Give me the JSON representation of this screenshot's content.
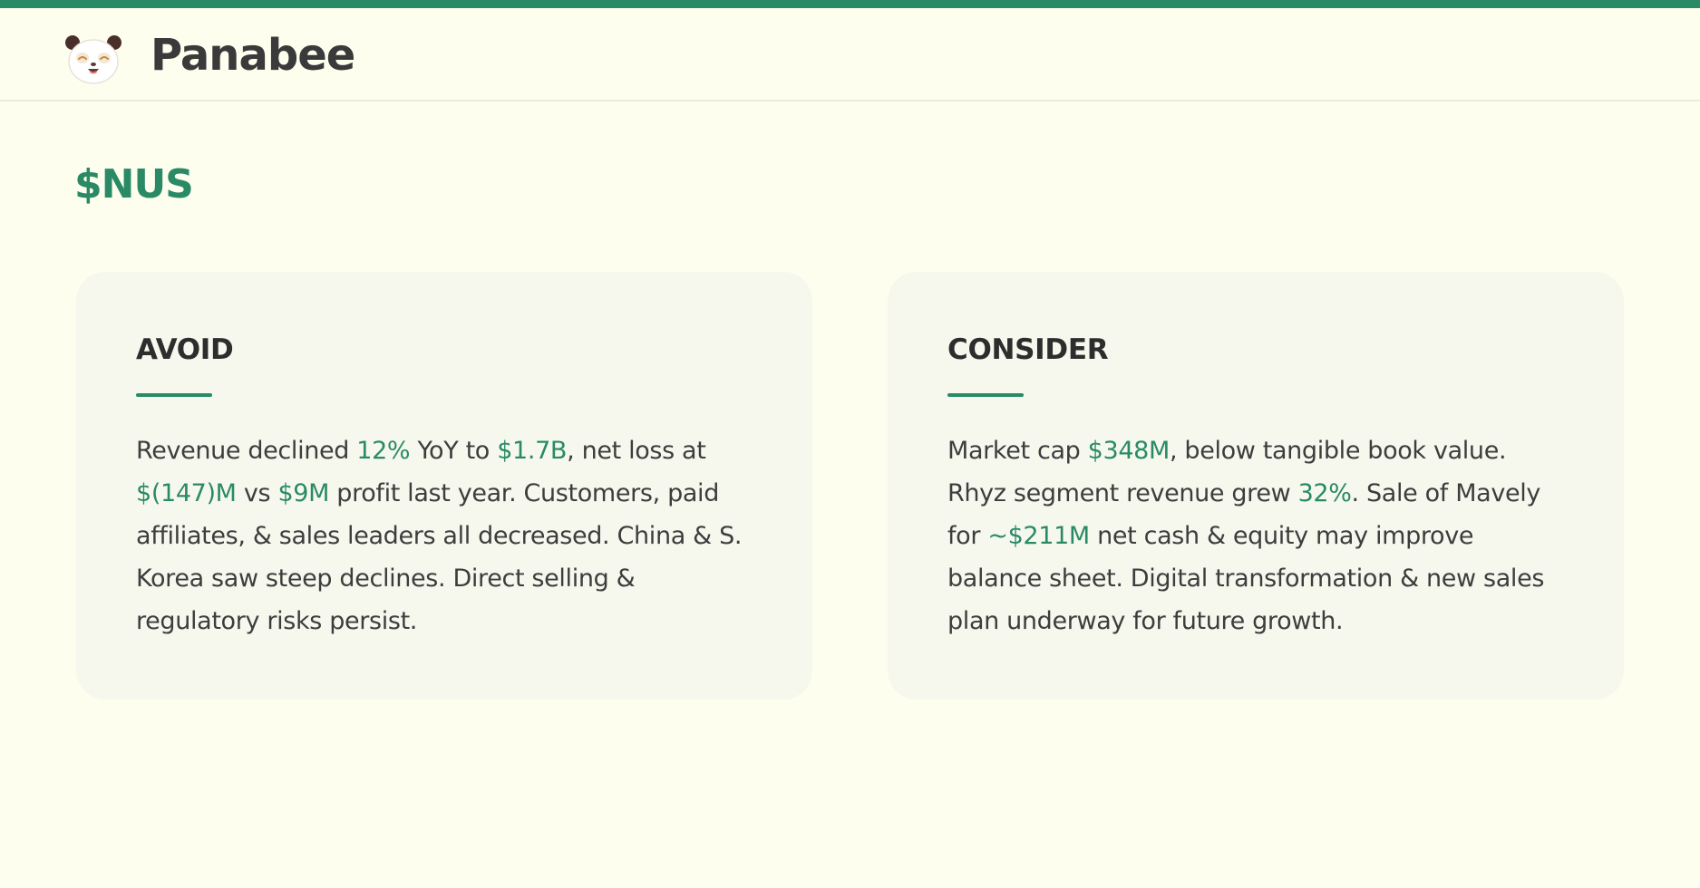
{
  "header": {
    "brand_name": "Panabee",
    "logo_icon": "panda-face-icon",
    "accent_color": "#2a8a66"
  },
  "page": {
    "ticker": "$NUS"
  },
  "cards": {
    "avoid": {
      "title": "AVOID",
      "segments": [
        {
          "text": "Revenue declined ",
          "highlight": false
        },
        {
          "text": "12%",
          "highlight": true
        },
        {
          "text": " YoY to ",
          "highlight": false
        },
        {
          "text": "$1.7B",
          "highlight": true
        },
        {
          "text": ", net loss at ",
          "highlight": false
        },
        {
          "text": "$(147)M",
          "highlight": true
        },
        {
          "text": " vs ",
          "highlight": false
        },
        {
          "text": "$9M",
          "highlight": true
        },
        {
          "text": " profit last year. Customers, paid affiliates, & sales leaders all decreased. China & S. Korea saw steep declines. Direct selling & regulatory risks persist.",
          "highlight": false
        }
      ]
    },
    "consider": {
      "title": "CONSIDER",
      "segments": [
        {
          "text": "Market cap ",
          "highlight": false
        },
        {
          "text": "$348M",
          "highlight": true
        },
        {
          "text": ", below tangible book value. Rhyz segment revenue grew ",
          "highlight": false
        },
        {
          "text": "32%",
          "highlight": true
        },
        {
          "text": ". Sale of Mavely for ",
          "highlight": false
        },
        {
          "text": "~$211M",
          "highlight": true
        },
        {
          "text": " net cash & equity may improve balance sheet. Digital transformation & new sales plan underway for future growth.",
          "highlight": false
        }
      ]
    }
  }
}
